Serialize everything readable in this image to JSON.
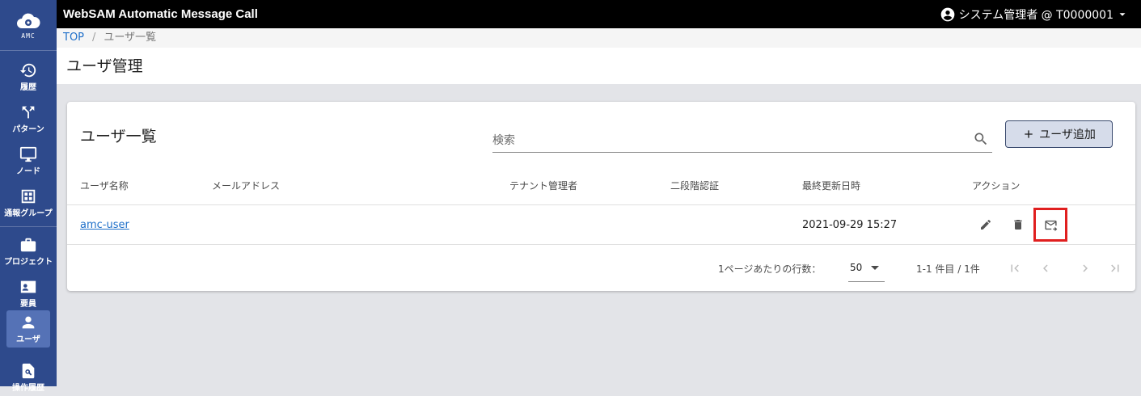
{
  "app": {
    "title": "WebSAM Automatic Message Call",
    "logo_text": "AMC"
  },
  "user_menu": {
    "label": "システム管理者 @ T0000001"
  },
  "sidebar": {
    "items": [
      {
        "label": "履歴",
        "icon": "history-icon"
      },
      {
        "label": "パターン",
        "icon": "split-arrow-icon"
      },
      {
        "label": "ノード",
        "icon": "monitor-icon"
      },
      {
        "label": "通報グループ",
        "icon": "group-icon"
      },
      {
        "label": "プロジェクト",
        "icon": "briefcase-icon"
      },
      {
        "label": "要員",
        "icon": "contact-card-icon"
      },
      {
        "label": "ユーザ",
        "icon": "person-icon"
      },
      {
        "label": "操作履歴",
        "icon": "document-search-icon"
      }
    ],
    "active": "ユーザ"
  },
  "breadcrumb": {
    "top": "TOP",
    "separator": "/",
    "current": "ユーザ一覧"
  },
  "page": {
    "title": "ユーザ管理"
  },
  "card": {
    "title": "ユーザ一覧",
    "search_placeholder": "検索",
    "add_button": "ユーザ追加"
  },
  "table": {
    "columns": [
      "ユーザ名称",
      "メールアドレス",
      "テナント管理者",
      "二段階認証",
      "最終更新日時",
      "アクション"
    ],
    "rows": [
      {
        "name": "amc-user",
        "email": "",
        "tenant_admin": "",
        "two_factor": "",
        "updated": "2021-09-29 15:27",
        "actions": [
          "edit-icon",
          "delete-icon",
          "mail-send-icon"
        ]
      }
    ]
  },
  "pagination": {
    "rows_per_page_label": "1ページあたりの行数：",
    "rows_per_page": "50",
    "range": "1-1 件目 / 1件"
  },
  "colors": {
    "sidebar": "#2e4a8c",
    "sidebar_active": "#5572b6",
    "topbar": "#000000",
    "link": "#1e6fc9",
    "highlight": "#e01f1f",
    "add_button_bg": "#d6dcea"
  }
}
